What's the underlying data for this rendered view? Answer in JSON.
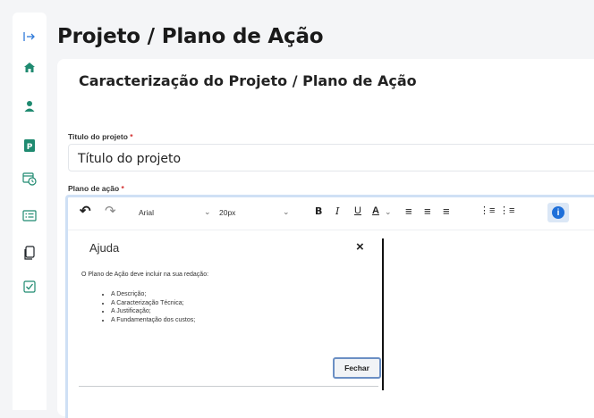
{
  "sidebar": {
    "items": [
      {
        "name": "expand-sidebar-icon",
        "glyph": "|→",
        "color": "#2f7ad9"
      },
      {
        "name": "home-icon",
        "glyph": "⌂",
        "color": "#1f8a70"
      },
      {
        "name": "user-icon",
        "glyph": "●",
        "color": "#1f8a70"
      },
      {
        "name": "project-icon",
        "glyph": "P",
        "color": "#1f8a70"
      },
      {
        "name": "calendar-clock-icon",
        "glyph": "◷",
        "color": "#1f8a70"
      },
      {
        "name": "list-card-icon",
        "glyph": "☰",
        "color": "#1f8a70"
      },
      {
        "name": "copy-icon",
        "glyph": "❐",
        "color": "#1f2328"
      },
      {
        "name": "checkbox-icon",
        "glyph": "☑",
        "color": "#1f8a70"
      }
    ]
  },
  "page": {
    "title": "Projeto / Plano de Ação"
  },
  "card": {
    "title": "Caracterização do Projeto / Plano de Ação"
  },
  "form": {
    "project_title_label": "Titulo do projeto",
    "project_title_required": "*",
    "project_title_value": "Título do projeto",
    "action_plan_label": "Plano de ação",
    "action_plan_required": "*"
  },
  "editor": {
    "toolbar": {
      "undo": "↶",
      "redo": "↷",
      "font_family": "Arial",
      "font_size": "20px",
      "bold": "B",
      "italic": "I",
      "underline": "U",
      "text_color": "A",
      "align_left": "≡",
      "align_center": "≡",
      "align_justify": "≡",
      "ordered_list": "⋮≡",
      "bullet_list": "⋮≡",
      "info": "i"
    }
  },
  "dialog": {
    "title": "Ajuda",
    "close": "×",
    "intro": "O Plano de Ação deve incluir na sua redação:",
    "items": [
      "A Descrição;",
      "A Caracterização Técnica;",
      "A Justificação;",
      "A Fundamentação dos custos;"
    ],
    "button": "Fechar"
  },
  "colors": {
    "accent": "#1e6fd9",
    "brand": "#1f8a70",
    "required": "#d32f2f"
  }
}
